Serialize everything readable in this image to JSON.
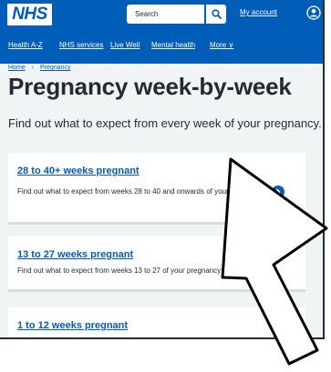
{
  "header": {
    "logo": "NHS",
    "search_placeholder": "Search",
    "account_label": "My account",
    "nav": [
      "Health A-Z",
      "NHS services",
      "Live Well",
      "Mental health",
      "More ∨"
    ]
  },
  "breadcrumb": {
    "home": "Home",
    "separator": "›",
    "current": "Pregnancy"
  },
  "page": {
    "title": "Pregnancy week-by-week",
    "lede": "Find out what to expect from every week of your pregnancy."
  },
  "cards": [
    {
      "title": "28 to 40+ weeks pregnant",
      "description": "Find out what to expect from weeks 28 to 40 and onwards of your pregnancy"
    },
    {
      "title": "13 to 27 weeks pregnant",
      "description": "Find out what to expect from weeks 13 to 27 of your pregnancy"
    },
    {
      "title": "1 to 12 weeks pregnant"
    }
  ],
  "icons": {
    "search": "search-icon",
    "account": "user-circle-icon",
    "chevron": "chevron-right-circle-icon",
    "cursor": "mouse-pointer-icon"
  },
  "colors": {
    "brand": "#005eb8",
    "text": "#212b32",
    "background": "#f0f4f5"
  }
}
